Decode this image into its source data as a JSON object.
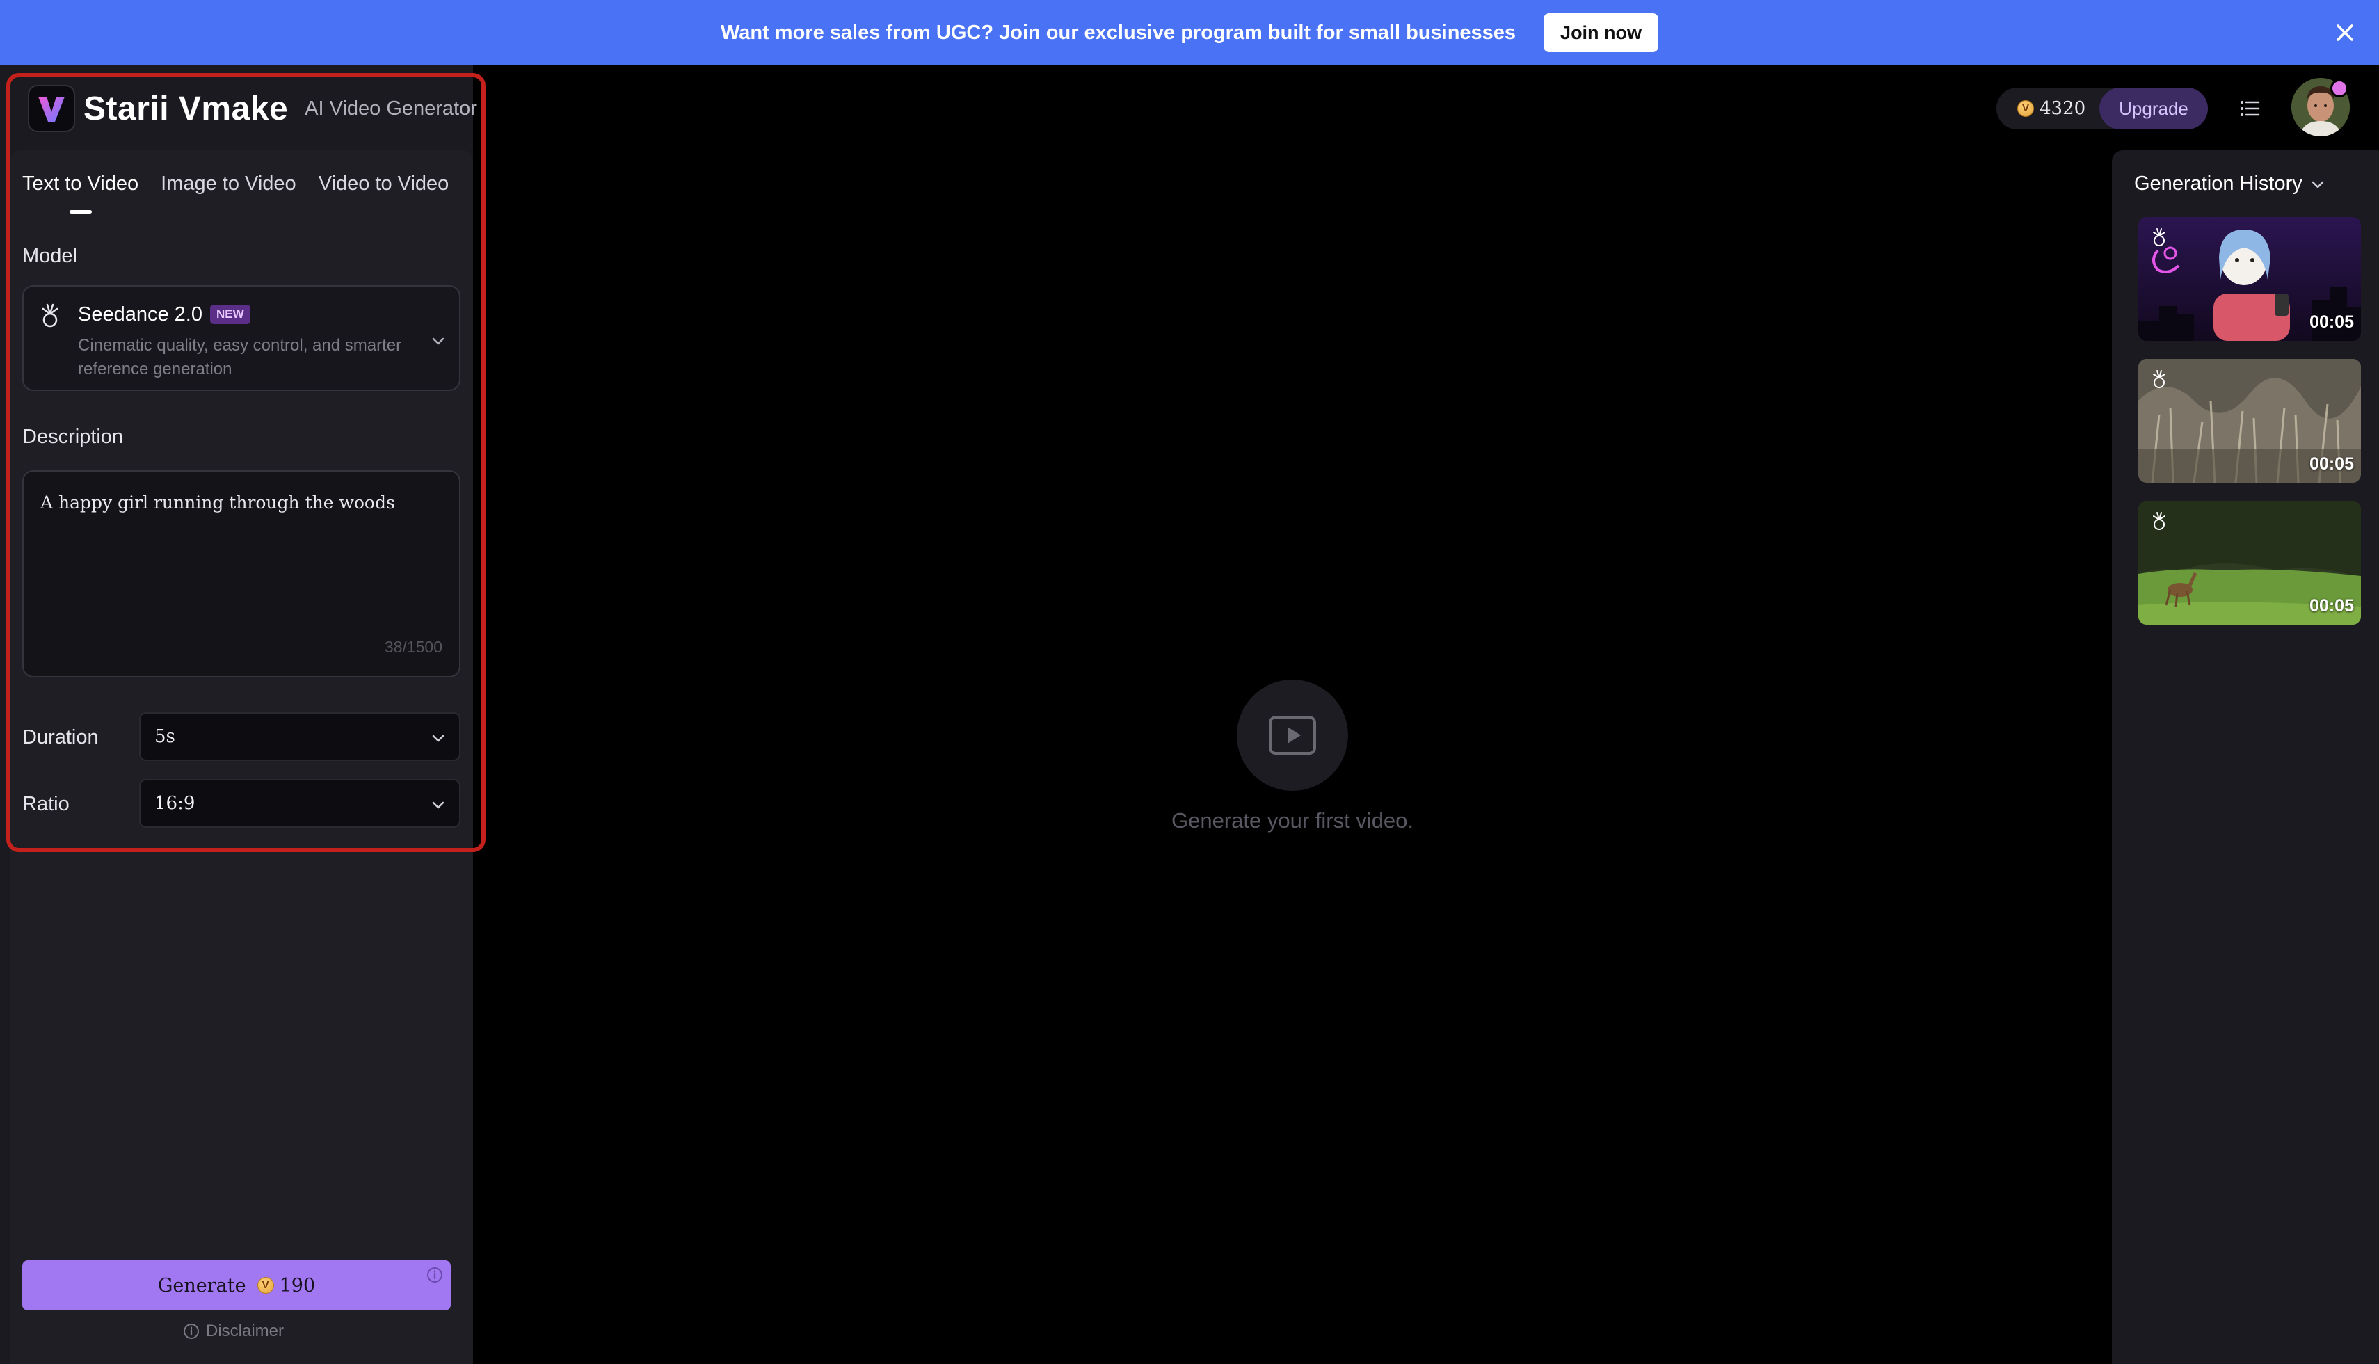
{
  "banner": {
    "text": "Want more sales from UGC? Join our exclusive program built for small businesses",
    "button": "Join now"
  },
  "brand": {
    "name": "Starii Vmake",
    "subtitle": "AI Video Generator"
  },
  "tabs": [
    {
      "label": "Text to Video",
      "active": true
    },
    {
      "label": "Image to Video",
      "active": false
    },
    {
      "label": "Video to Video",
      "active": false
    }
  ],
  "model": {
    "label": "Model",
    "name": "Seedance 2.0",
    "badge": "NEW",
    "description": "Cinematic quality, easy control, and smarter reference generation"
  },
  "description": {
    "label": "Description",
    "value": "A happy girl running through the woods",
    "count": "38/1500"
  },
  "duration": {
    "label": "Duration",
    "value": "5s"
  },
  "ratio": {
    "label": "Ratio",
    "value": "16:9"
  },
  "generate": {
    "label": "Generate",
    "cost": "190"
  },
  "disclaimer": "Disclaimer",
  "center": {
    "message": "Generate your first video."
  },
  "header": {
    "credits": "4320",
    "upgrade": "Upgrade"
  },
  "history": {
    "title": "Generation History",
    "items": [
      {
        "duration": "00:05"
      },
      {
        "duration": "00:05"
      },
      {
        "duration": "00:05"
      }
    ]
  },
  "colors": {
    "banner": "#4a72f5",
    "accent": "#a277f2",
    "highlight": "#c4211c"
  }
}
